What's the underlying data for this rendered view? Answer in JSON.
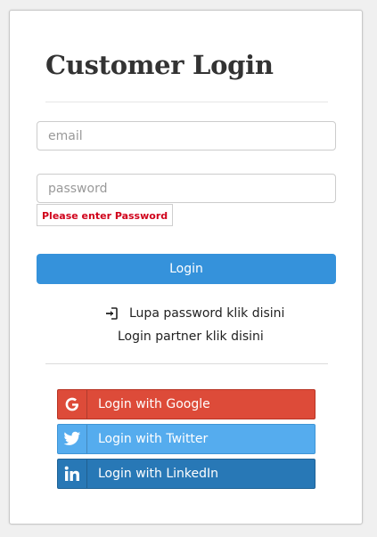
{
  "page": {
    "title": "Customer Login"
  },
  "form": {
    "email_placeholder": "email",
    "password_placeholder": "password",
    "password_error": "Please enter Password",
    "login_label": "Login"
  },
  "links": {
    "forgot_password": "Lupa password klik disini",
    "partner_login": "Login partner klik disini"
  },
  "social": {
    "google": "Login with Google",
    "twitter": "Login with Twitter",
    "linkedin": "Login with LinkedIn"
  },
  "colors": {
    "primary": "#3592db",
    "error": "#d0021b",
    "google": "#dd4b39",
    "twitter": "#55acee",
    "linkedin": "#2878b6"
  },
  "icons": {
    "forgot_password": "sign-in-icon",
    "google": "google-icon",
    "twitter": "twitter-icon",
    "linkedin": "linkedin-icon"
  }
}
